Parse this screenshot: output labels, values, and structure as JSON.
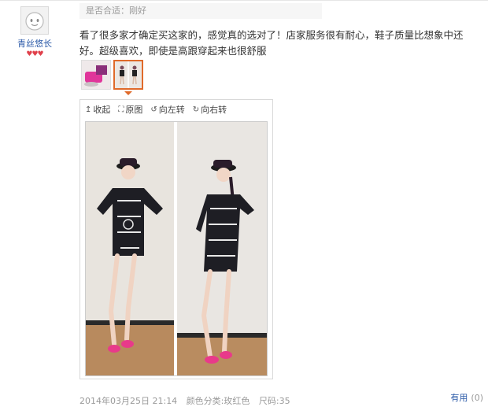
{
  "user": {
    "name": "青丝悠长",
    "hearts": "♥♥♥"
  },
  "review": {
    "fit_label": "是否合适：",
    "fit_value": "刚好",
    "text": "看了很多家才确定买这家的，感觉真的选对了！店家服务很有耐心，鞋子质量比想象中还好。超级喜欢，即使是高跟穿起来也很舒服"
  },
  "thumbnails": [
    {
      "name": "thumb-1",
      "selected": false
    },
    {
      "name": "thumb-2",
      "selected": true
    }
  ],
  "viewer": {
    "tools": [
      {
        "icon": "↥",
        "label": "收起"
      },
      {
        "icon": "⛶",
        "label": "原图"
      },
      {
        "icon": "↺",
        "label": "向左转"
      },
      {
        "icon": "↻",
        "label": "向右转"
      }
    ]
  },
  "meta": {
    "date": "2014年03月25日 21:14",
    "color": "颜色分类:玫红色",
    "size": "尺码:35"
  },
  "useful": {
    "label": "有用",
    "count": "(0)"
  },
  "colors": {
    "accent": "#e06a2a",
    "link": "#2b5aa8",
    "heart": "#e0404b"
  }
}
